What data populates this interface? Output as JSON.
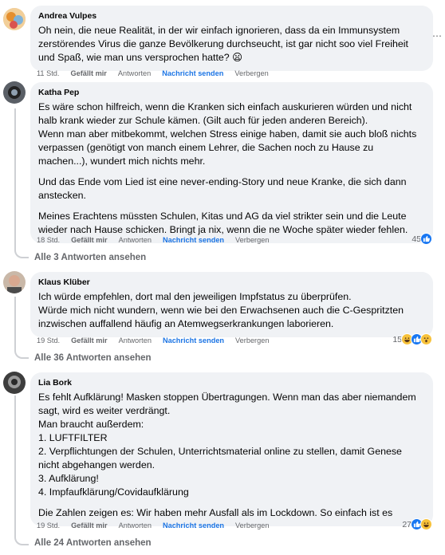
{
  "comments": [
    {
      "author": "Andrea Vulpes",
      "paragraphs": [
        "Oh nein, die neue Realität, in der wir einfach ignorieren, dass da ein Immunsystem zerstörendes Virus die ganze Bevölkerung durchseucht, ist gar nicht soo viel Freiheit und Spaß, wie man uns versprochen hatte? 😦"
      ],
      "time": "11 Std.",
      "like": "Gefällt mir",
      "reply": "Antworten",
      "message": "Nachricht senden",
      "hide": "Verbergen"
    },
    {
      "author": "Katha Pep",
      "paragraphs": [
        "Es wäre schon hilfreich, wenn die Kranken sich einfach auskurieren würden und nicht halb krank wieder zur Schule kämen. (Gilt auch für jeden anderen Bereich).",
        "Wenn man aber mitbekommt, welchen Stress einige haben, damit sie auch bloß nichts verpassen (genötigt von manch einem Lehrer, die Sachen noch zu Hause zu machen...), wundert mich nichts mehr.",
        "Und das Ende vom Lied ist eine never-ending-Story und neue Kranke, die sich dann anstecken.",
        "Meines Erachtens müssten Schulen, Kitas und AG da viel strikter sein und die Leute wieder nach Hause schicken. Bringt ja nix, wenn die ne Woche später wieder fehlen."
      ],
      "time": "18 Std.",
      "like": "Gefällt mir",
      "reply": "Antworten",
      "message": "Nachricht senden",
      "hide": "Verbergen",
      "reaction_count": "45",
      "more_replies": "Alle 3 Antworten ansehen"
    },
    {
      "author": "Klaus Klüber",
      "paragraphs": [
        "Ich würde empfehlen, dort mal den jeweiligen Impfstatus zu überprüfen.",
        "Würde mich nicht wundern, wenn wie bei den Erwachsenen auch die C-Gespritzten inzwischen auffallend häufig an Atemwegserkrankungen laborieren."
      ],
      "time": "19 Std.",
      "like": "Gefällt mir",
      "reply": "Antworten",
      "message": "Nachricht senden",
      "hide": "Verbergen",
      "reaction_count": "15",
      "more_replies": "Alle 36 Antworten ansehen"
    },
    {
      "author": "Lia Bork",
      "paragraphs": [
        "Es fehlt Aufklärung! Masken stoppen Übertragungen. Wenn man das aber niemandem sagt, wird es weiter verdrängt.",
        "Man braucht außerdem:",
        "1. LUFTFILTER",
        "2. Verpflichtungen der Schulen, Unterrichtsmaterial online zu stellen, damit Genese nicht abgehangen werden.",
        "3. Aufklärung!",
        "4. Impfaufklärung/Covidaufklärung",
        "Die Zahlen zeigen es: Wir haben mehr Ausfall als im Lockdown. So einfach ist es"
      ],
      "time": "19 Std.",
      "like": "Gefällt mir",
      "reply": "Antworten",
      "message": "Nachricht senden",
      "hide": "Verbergen",
      "reaction_count": "27",
      "more_replies": "Alle 24 Antworten ansehen"
    }
  ],
  "colors": {
    "bubble": "#f0f2f5",
    "meta": "#65676b",
    "link": "#1b74e4",
    "like": "#1877f2",
    "haha": "#f7c23b"
  }
}
